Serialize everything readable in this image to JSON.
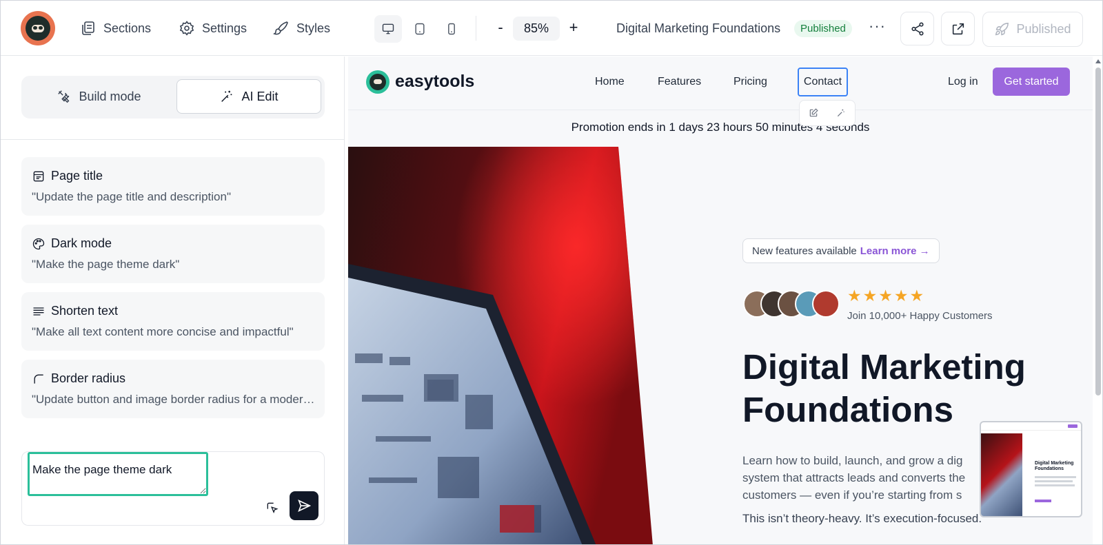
{
  "toolbar": {
    "sections_label": "Sections",
    "settings_label": "Settings",
    "styles_label": "Styles",
    "zoom_minus": "-",
    "zoom_value": "85%",
    "zoom_plus": "+",
    "doc_title": "Digital Marketing Foundations",
    "status_badge": "Published",
    "more": "···",
    "publish_label": "Published"
  },
  "left_panel": {
    "build_mode_label": "Build mode",
    "ai_edit_label": "AI Edit",
    "suggestions": [
      {
        "title": "Page title",
        "desc": "\"Update the page title and description\"",
        "icon": "page-title-icon"
      },
      {
        "title": "Dark mode",
        "desc": "\"Make the page theme dark\"",
        "icon": "palette-icon"
      },
      {
        "title": "Shorten text",
        "desc": "\"Make all text content more concise and impactful\"",
        "icon": "lines-icon"
      },
      {
        "title": "Border radius",
        "desc": "\"Update button and image border radius for a modern look\"",
        "icon": "corner-icon"
      }
    ],
    "prompt_value": "Make the page theme dark"
  },
  "preview": {
    "brand": "easytools",
    "nav": [
      "Home",
      "Features",
      "Pricing",
      "Contact"
    ],
    "login": "Log in",
    "get_started": "Get started",
    "promo": "Promotion ends in 1 days 23 hours 50 minutes 4 seconds",
    "pill_text": "New features available",
    "pill_link": "Learn more →",
    "stars": "★★★★★",
    "rating": "Join 10,000+ Happy Customers",
    "headline": "Digital Marketing Foundations",
    "paragraph": "Learn how to build, launch, and grow a dig\nsystem that attracts leads and converts the\ncustomers — even if you’re starting from s",
    "paragraph2": "This isn’t theory-heavy. It’s execution-focused.",
    "minimap_title": "Digital Marketing Foundations"
  },
  "colors": {
    "accent_purple": "#9b67dd",
    "accent_teal": "#2bbf9a",
    "selection_blue": "#3b82f6",
    "published_green": "#15803d",
    "logo_orange": "#e8734f"
  }
}
